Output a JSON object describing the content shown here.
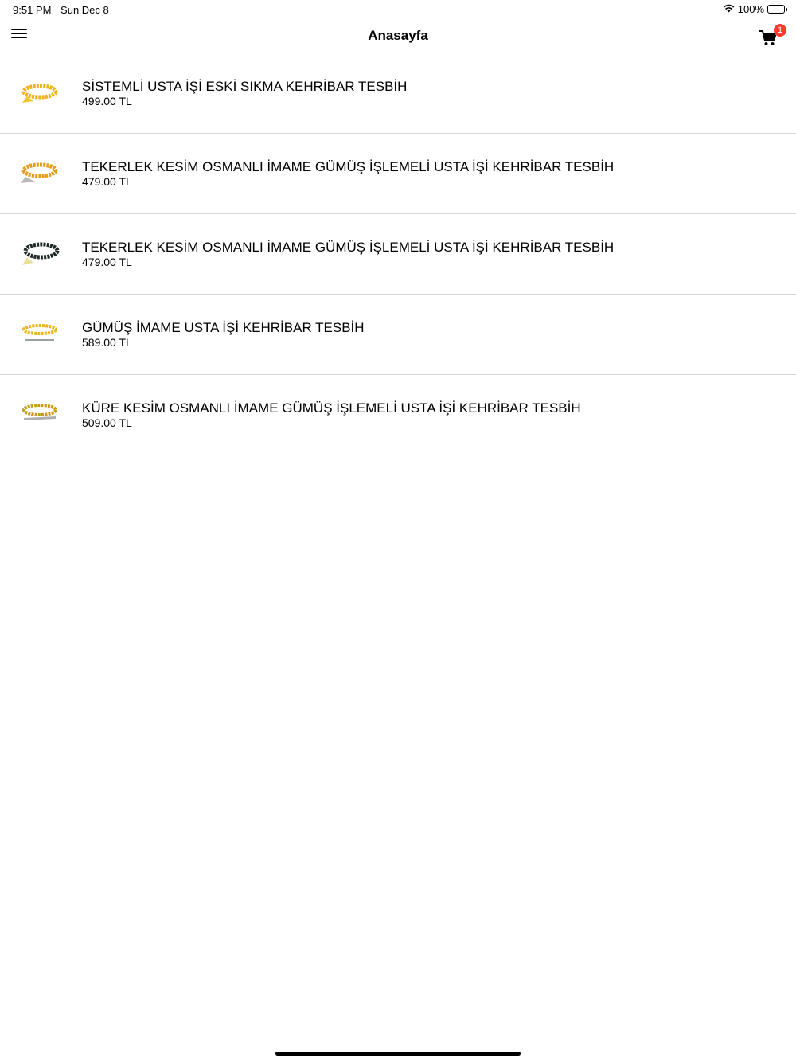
{
  "status": {
    "time": "9:51 PM",
    "date": "Sun Dec 8",
    "battery": "100%"
  },
  "nav": {
    "title": "Anasayfa",
    "cart_count": "1"
  },
  "products": [
    {
      "name": "SİSTEMLİ USTA İŞİ ESKİ SIKMA KEHRİBAR TESBİH",
      "price": "499.00 TL",
      "bead_color": "#f2b21e",
      "tassel_color": "#f4c531"
    },
    {
      "name": "TEKERLEK KESİM OSMANLI İMAME GÜMÜŞ İŞLEMELİ USTA İŞİ KEHRİBAR TESBİH",
      "price": "479.00 TL",
      "bead_color": "#e89a1a",
      "tassel_color": "#b9b9b9"
    },
    {
      "name": "TEKERLEK KESİM OSMANLI İMAME GÜMÜŞ İŞLEMELİ USTA İŞİ KEHRİBAR TESBİH",
      "price": "479.00 TL",
      "bead_color": "#1f2a25",
      "tassel_color": "#e8e39a"
    },
    {
      "name": "GÜMÜŞ İMAME USTA İŞİ KEHRİBAR TESBİH",
      "price": "589.00 TL",
      "bead_color": "#f0b51f",
      "tassel_color": "#9aa1a0"
    },
    {
      "name": "KÜRE KESİM OSMANLI İMAME GÜMÜŞ İŞLEMELİ USTA İŞİ KEHRİBAR TESBİH",
      "price": "509.00 TL",
      "bead_color": "#c99a10",
      "tassel_color": "#b0b0b0"
    }
  ]
}
